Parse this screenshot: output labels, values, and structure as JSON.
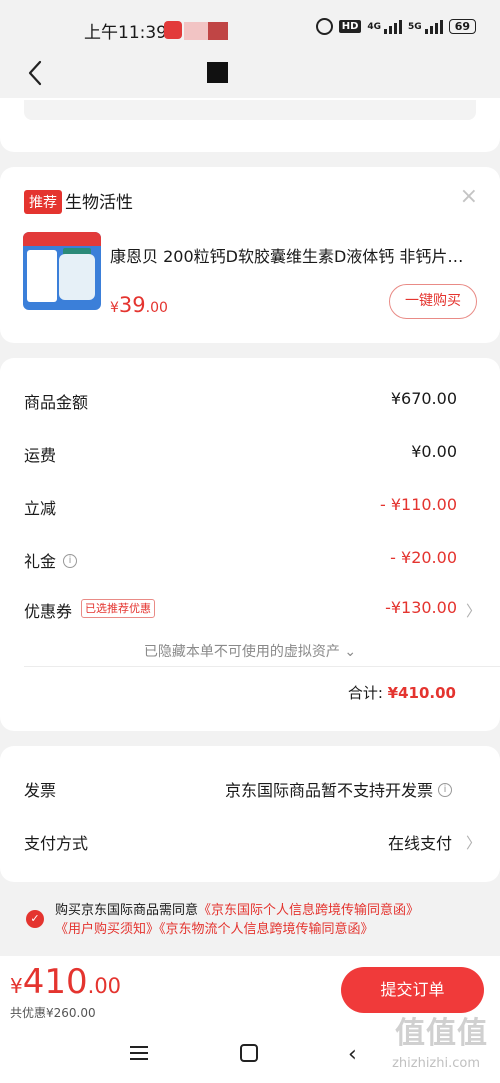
{
  "status_bar": {
    "time": "上午11:39",
    "net1": "4G",
    "net2": "5G",
    "hd": "HD",
    "battery": "69"
  },
  "recommendation": {
    "tag": "推荐",
    "title": "生物活性",
    "close": "×",
    "product_name": "康恩贝 200粒钙D软胶囊维生素D液体钙 非钙片…",
    "price_symbol": "¥",
    "price_int": "39",
    "price_dec": ".00",
    "buy_label": "一键购买"
  },
  "summary": {
    "rows": [
      {
        "label": "商品金额",
        "value": "¥670.00"
      },
      {
        "label": "运费",
        "value": "¥0.00"
      },
      {
        "label": "立减",
        "value": "- ¥110.00"
      },
      {
        "label": "礼金",
        "value": "- ¥20.00"
      },
      {
        "label": "优惠券",
        "value": "-¥130.00",
        "badge": "已选推荐优惠"
      }
    ],
    "hidden_assets": "已隐藏本单不可使用的虚拟资产 ⌄",
    "total_label": "合计: ",
    "total_value": "¥410.00"
  },
  "invoice": {
    "label": "发票",
    "value": "京东国际商品暂不支持开发票",
    "payment_label": "支付方式",
    "payment_value": "在线支付"
  },
  "agreement": {
    "prefix": "购买京东国际商品需同意",
    "link1": "《京东国际个人信息跨境传输同意函》",
    "link2": "《用户购买须知》",
    "link3": "《京东物流个人信息跨境传输同意函》"
  },
  "bottom": {
    "price_symbol": "¥",
    "price_int": "410",
    "price_dec": ".00",
    "discount": "共优惠¥260.00",
    "submit_label": "提交订单"
  },
  "watermark": {
    "main": "值值值",
    "sub": "zhizhizhi.com"
  },
  "colors": {
    "accent": "#e4342f",
    "background": "#f2f2f2",
    "card": "#ffffff"
  }
}
